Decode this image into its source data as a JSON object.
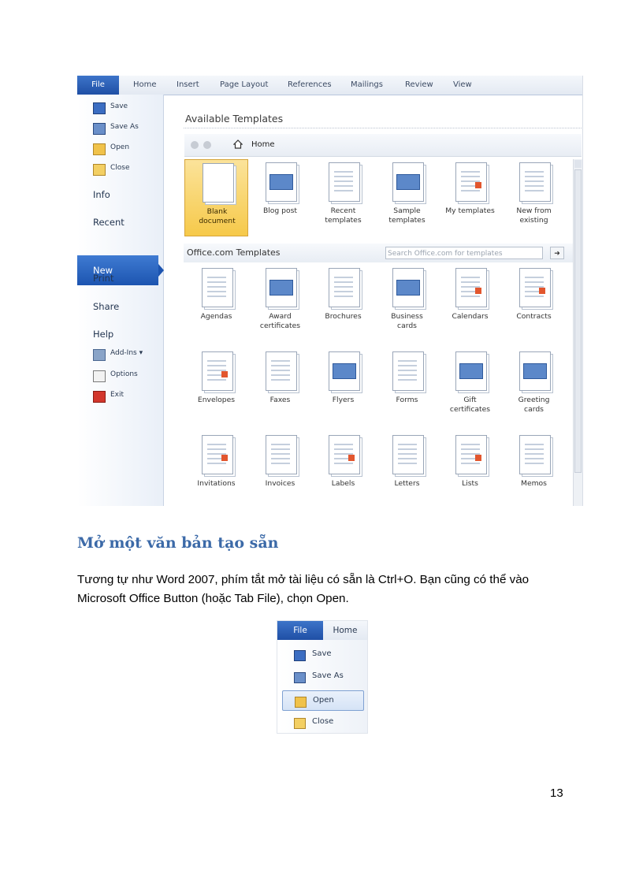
{
  "screenshot1": {
    "ribbon_tabs": [
      "File",
      "Home",
      "Insert",
      "Page Layout",
      "References",
      "Mailings",
      "Review",
      "View"
    ],
    "left_menu": {
      "small_items": [
        {
          "label": "Save",
          "icon": "save-icon"
        },
        {
          "label": "Save As",
          "icon": "save-as-icon"
        },
        {
          "label": "Open",
          "icon": "open-folder-icon"
        },
        {
          "label": "Close",
          "icon": "close-folder-icon"
        }
      ],
      "info": "Info",
      "recent": "Recent",
      "new": "New",
      "print": "Print",
      "share": "Share",
      "help": "Help",
      "bottom_items": [
        {
          "label": "Add-Ins ▾",
          "icon": "add-ins-icon"
        },
        {
          "label": "Options",
          "icon": "options-icon"
        },
        {
          "label": "Exit",
          "icon": "exit-icon"
        }
      ]
    },
    "available_templates": "Available Templates",
    "nav_home": "Home",
    "top_templates": [
      {
        "line1": "Blank",
        "line2": "document",
        "icon": "blank-document-icon"
      },
      {
        "line1": "Blog post",
        "line2": "",
        "icon": "blog-post-icon"
      },
      {
        "line1": "Recent",
        "line2": "templates",
        "icon": "recent-templates-icon"
      },
      {
        "line1": "Sample",
        "line2": "templates",
        "icon": "sample-templates-icon"
      },
      {
        "line1": "My templates",
        "line2": "",
        "icon": "my-templates-icon"
      },
      {
        "line1": "New from",
        "line2": "existing",
        "icon": "new-from-existing-icon"
      }
    ],
    "office_com_title": "Office.com Templates",
    "search_placeholder": "Search Office.com for templates",
    "go_arrow": "➜",
    "office_templates": [
      {
        "line1": "Agendas",
        "line2": ""
      },
      {
        "line1": "Award",
        "line2": "certificates"
      },
      {
        "line1": "Brochures",
        "line2": ""
      },
      {
        "line1": "Business",
        "line2": "cards"
      },
      {
        "line1": "Calendars",
        "line2": ""
      },
      {
        "line1": "Contracts",
        "line2": ""
      },
      {
        "line1": "Envelopes",
        "line2": ""
      },
      {
        "line1": "Faxes",
        "line2": ""
      },
      {
        "line1": "Flyers",
        "line2": ""
      },
      {
        "line1": "Forms",
        "line2": ""
      },
      {
        "line1": "Gift",
        "line2": "certificates"
      },
      {
        "line1": "Greeting",
        "line2": "cards"
      },
      {
        "line1": "Invitations",
        "line2": ""
      },
      {
        "line1": "Invoices",
        "line2": ""
      },
      {
        "line1": "Labels",
        "line2": ""
      },
      {
        "line1": "Letters",
        "line2": ""
      },
      {
        "line1": "Lists",
        "line2": ""
      },
      {
        "line1": "Memos",
        "line2": ""
      }
    ]
  },
  "heading": "Mở một văn bản tạo sẵn",
  "paragraph": "Tương tự như Word 2007, phím tắt mở tài liệu có sẵn là Ctrl+O. Bạn cũng có thể vào Microsoft Office Button (hoặc Tab File), chọn Open.",
  "screenshot2": {
    "file_tab": "File",
    "home_tab": "Home",
    "items": [
      {
        "label": "Save",
        "icon": "save-icon"
      },
      {
        "label": "Save As",
        "icon": "save-as-icon"
      },
      {
        "label": "Open",
        "icon": "open-folder-icon"
      },
      {
        "label": "Close",
        "icon": "close-folder-icon"
      }
    ]
  },
  "page_number": "13"
}
